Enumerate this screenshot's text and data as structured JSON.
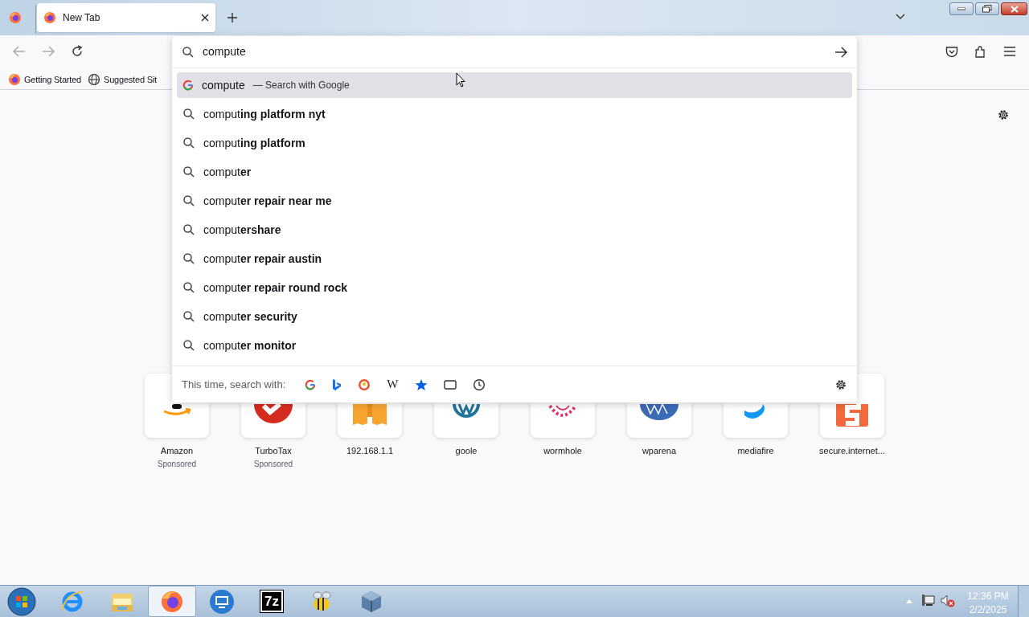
{
  "tabs": [
    {
      "label": "New Tab",
      "selected": true
    }
  ],
  "bookmarks": [
    {
      "label": "Getting Started",
      "kind": "firefox"
    },
    {
      "label": "Suggested Sit",
      "kind": "globe"
    }
  ],
  "address_bar": {
    "value": "compute"
  },
  "suggestions": [
    {
      "kind": "engine",
      "text": "compute",
      "action": "— Search with Google",
      "selected": true
    },
    {
      "kind": "search",
      "text": "comput**ing platform nyt**",
      "selected": false
    },
    {
      "kind": "search",
      "text": "comput**ing platform**",
      "selected": false
    },
    {
      "kind": "search",
      "text": "comput**er**",
      "selected": false
    },
    {
      "kind": "search",
      "text": "comput**er repair near me**",
      "selected": false
    },
    {
      "kind": "search",
      "text": "comput**ershare**",
      "selected": false
    },
    {
      "kind": "search",
      "text": "comput**er repair austin**",
      "selected": false
    },
    {
      "kind": "search",
      "text": "comput**er repair round rock**",
      "selected": false
    },
    {
      "kind": "search",
      "text": "comput**er security**",
      "selected": false
    },
    {
      "kind": "search",
      "text": "comput**er monitor**",
      "selected": false
    }
  ],
  "search_with": {
    "label": "This time, search with:",
    "engines": [
      {
        "kind": "google"
      },
      {
        "kind": "bing"
      },
      {
        "kind": "duckduckgo"
      },
      {
        "kind": "wikipedia",
        "icon_text": "W"
      },
      {
        "kind": "bookmarks"
      },
      {
        "kind": "tabs"
      },
      {
        "kind": "history"
      }
    ]
  },
  "top_sites": [
    {
      "label": "Amazon",
      "sponsored": "Sponsored",
      "kind": "amazon"
    },
    {
      "label": "TurboTax",
      "sponsored": "Sponsored",
      "kind": "turbotax"
    },
    {
      "label": "192.168.1.1",
      "kind": "bars"
    },
    {
      "label": "goole",
      "kind": "wordpress"
    },
    {
      "label": "wormhole",
      "kind": "wormhole"
    },
    {
      "label": "wparena",
      "kind": "wparena"
    },
    {
      "label": "mediafire",
      "kind": "mediafire"
    },
    {
      "label": "secure.internet...",
      "kind": "secure"
    }
  ],
  "taskbar": {
    "items": [
      {
        "kind": "ie",
        "selected": false
      },
      {
        "kind": "explorer",
        "selected": false
      },
      {
        "kind": "firefox",
        "selected": true
      },
      {
        "kind": "remote",
        "selected": false
      },
      {
        "kind": "sevenzip",
        "icon_text": "7z",
        "selected": false
      },
      {
        "kind": "bee",
        "selected": false
      },
      {
        "kind": "box",
        "selected": false
      }
    ],
    "time": "12:36 PM",
    "date": "2/2/2025"
  }
}
